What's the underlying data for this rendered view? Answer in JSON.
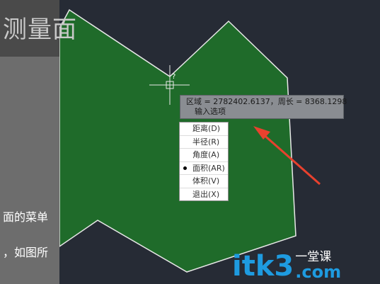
{
  "sidebar": {
    "title_text": "测量面",
    "line1": "面的菜单",
    "line2": "，如图所"
  },
  "tooltip": {
    "measurement": "区域 = 2782402.6137，周长 = 8368.1298",
    "prompt": "输入选项",
    "icon": "warning-icon"
  },
  "menu": {
    "items": [
      {
        "label": "距离(D)",
        "selected": false
      },
      {
        "label": "半径(R)",
        "selected": false
      },
      {
        "label": "角度(A)",
        "selected": false
      },
      {
        "label": "面积(AR)",
        "selected": true
      },
      {
        "label": "体积(V)",
        "selected": false
      },
      {
        "label": "退出(X)",
        "selected": false
      }
    ]
  },
  "cursor": {
    "marker": "?"
  },
  "watermark": {
    "latin": "itk3",
    "cn_top": "一堂课",
    "cn_bottom": ".com"
  },
  "colors": {
    "canvas_bg": "#262b35",
    "polygon_fill": "#1f6b2a",
    "arrow": "#e8412e",
    "accent": "#1e9be0"
  }
}
